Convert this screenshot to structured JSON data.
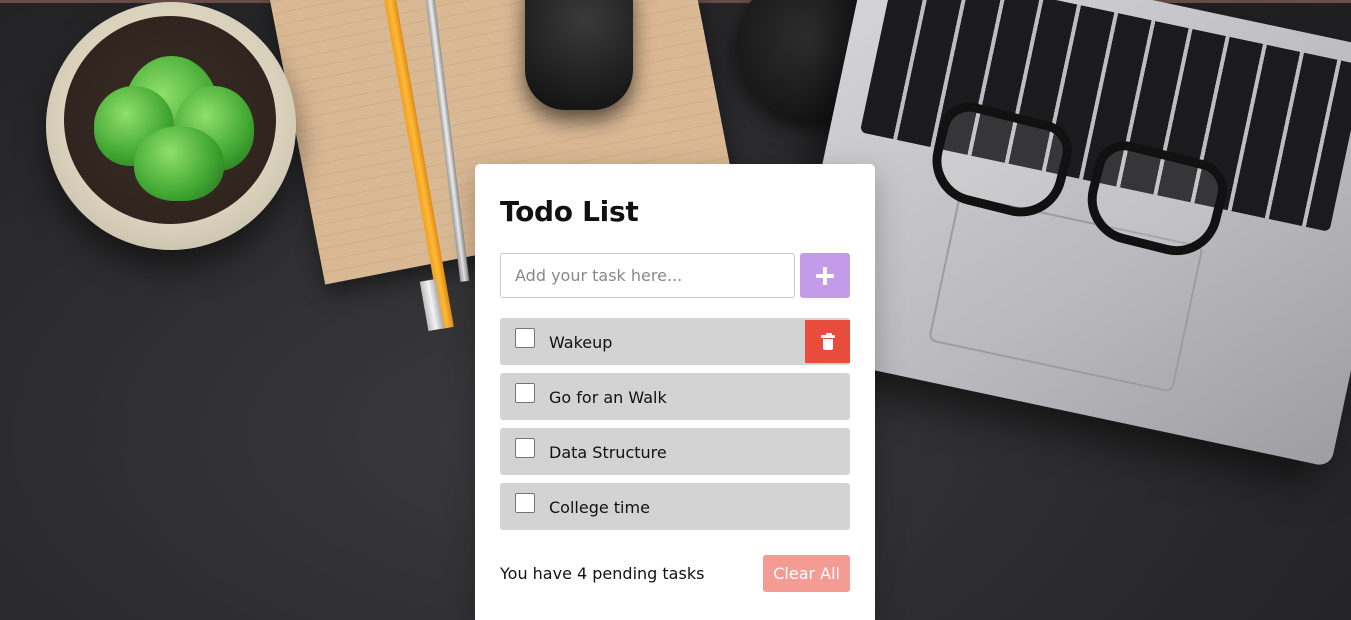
{
  "app": {
    "title": "Todo List"
  },
  "input": {
    "placeholder": "Add your task here...",
    "value": "",
    "add_icon": "plus-icon"
  },
  "tasks": [
    {
      "label": "Wakeup",
      "checked": false,
      "show_delete": true
    },
    {
      "label": "Go for an Walk",
      "checked": false,
      "show_delete": false
    },
    {
      "label": "Data Structure",
      "checked": false,
      "show_delete": false
    },
    {
      "label": "College time",
      "checked": false,
      "show_delete": false
    }
  ],
  "delete_icon": "trash-icon",
  "footer": {
    "pending_text": "You have 4 pending tasks",
    "clear_label": "Clear All"
  },
  "colors": {
    "add_button": "#c39be9",
    "delete_button": "#e74c3c",
    "clear_button": "#f49b93",
    "item_background": "#d3d3d3",
    "card_background": "#ffffff"
  }
}
